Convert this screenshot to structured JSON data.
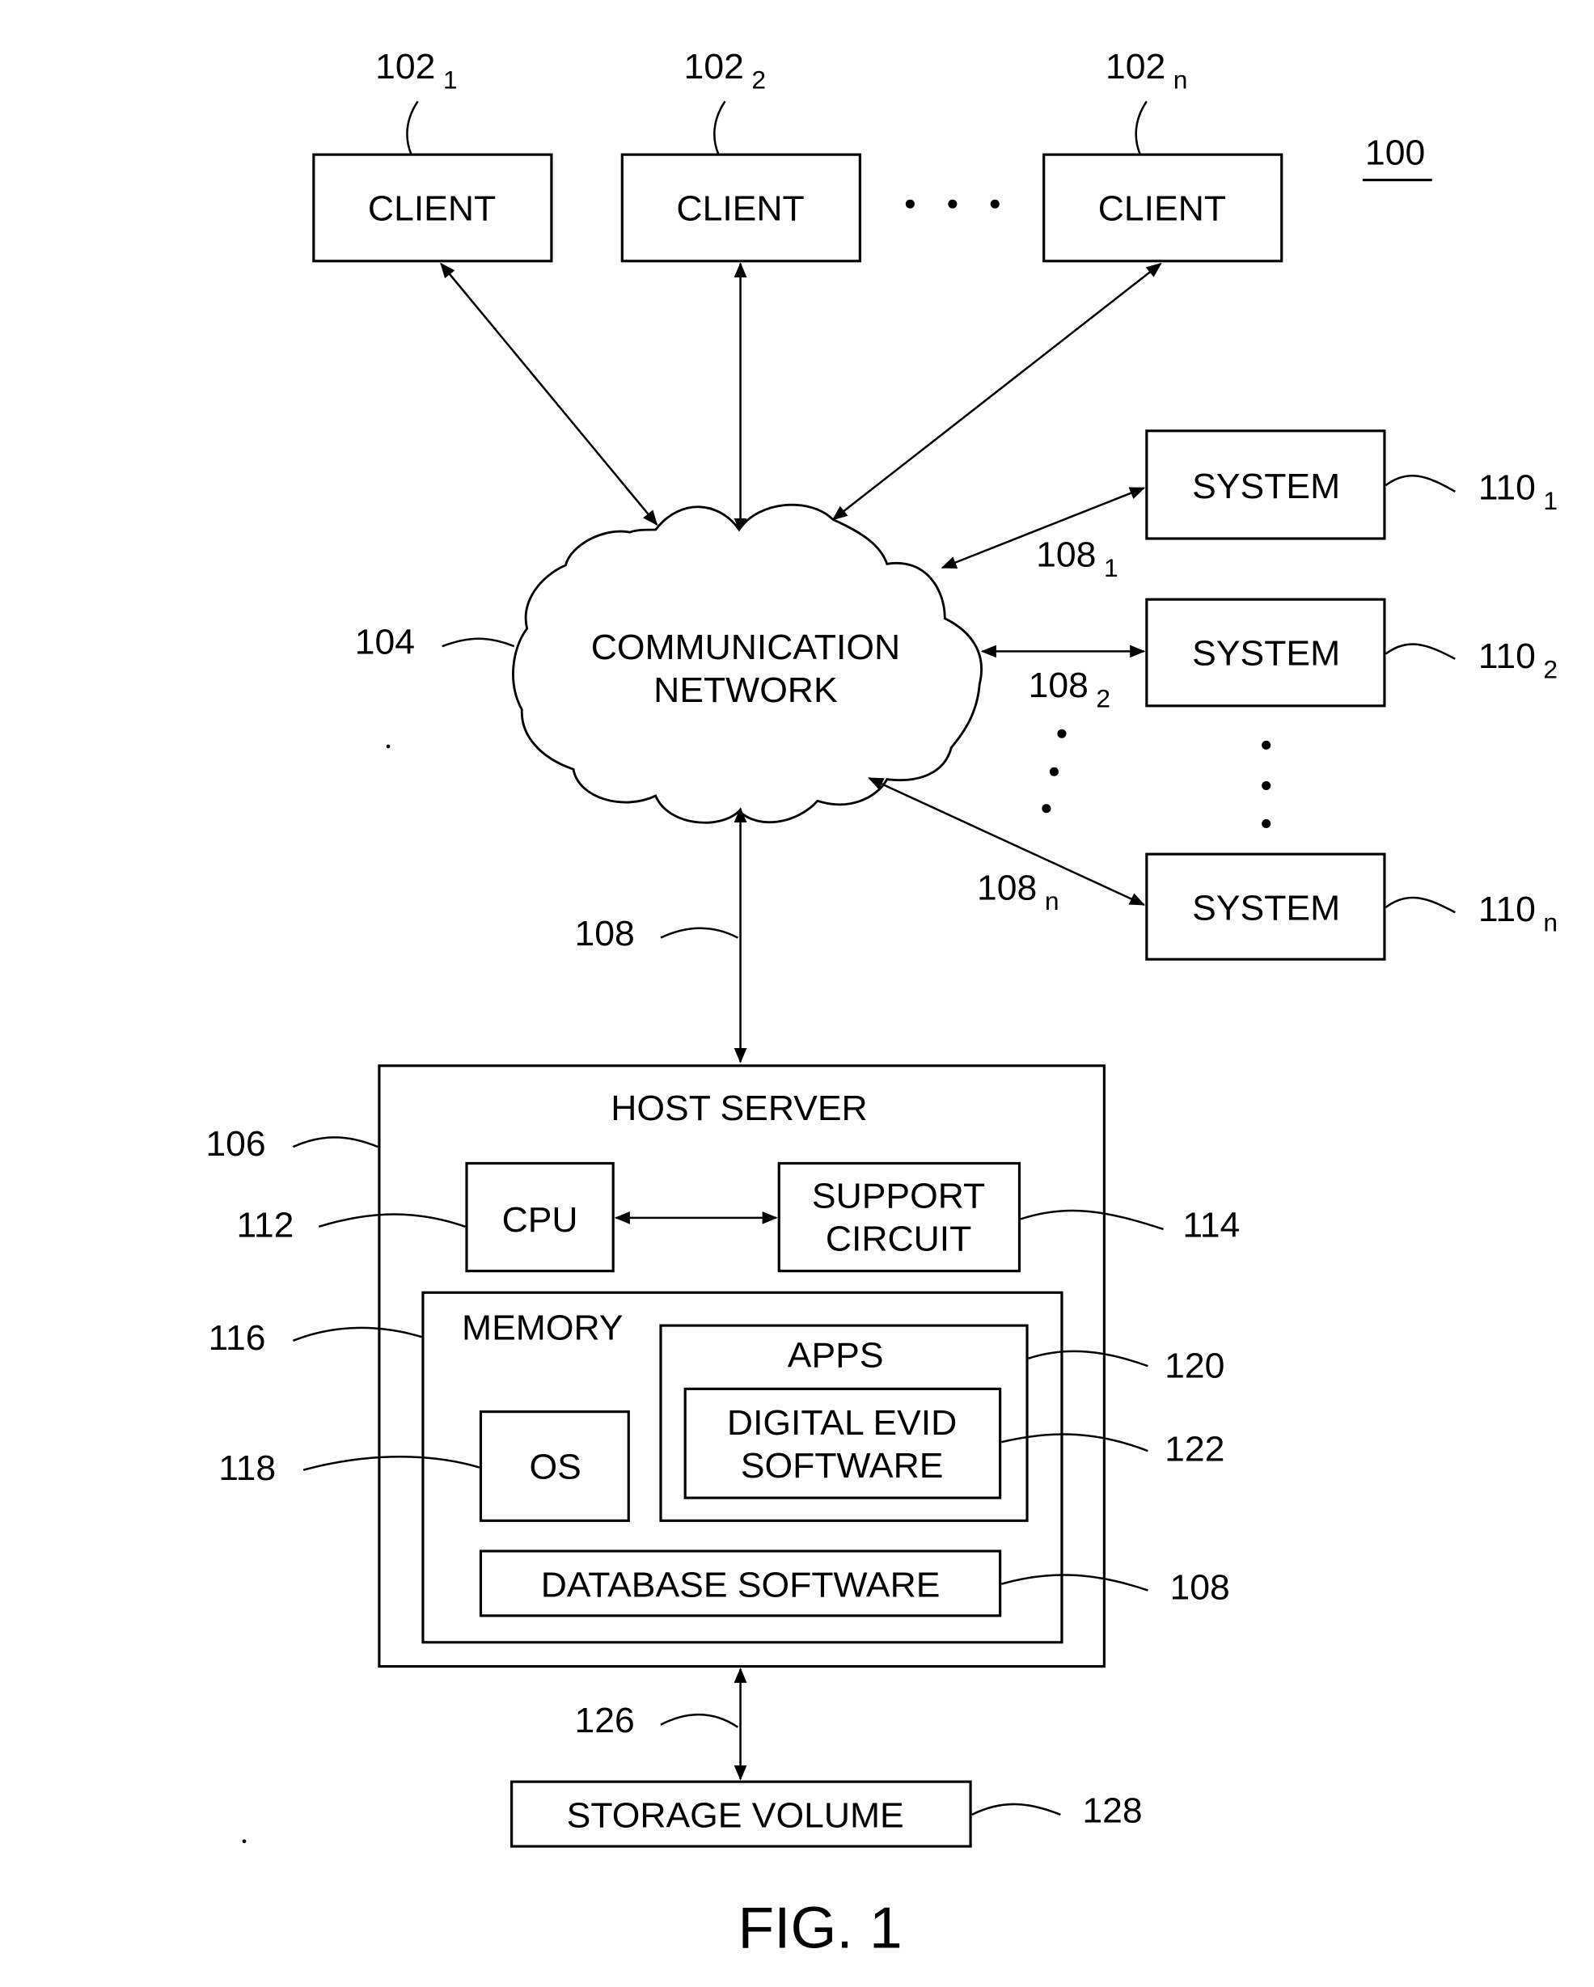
{
  "figure": {
    "title": "FIG. 1",
    "ref_number": "100"
  },
  "clients": [
    {
      "label": "CLIENT",
      "ref": "102",
      "sub": "1"
    },
    {
      "label": "CLIENT",
      "ref": "102",
      "sub": "2"
    },
    {
      "label": "CLIENT",
      "ref": "102",
      "sub": "n"
    }
  ],
  "network": {
    "line1": "COMMUNICATION",
    "line2": "NETWORK",
    "ref": "104"
  },
  "systems": [
    {
      "label": "SYSTEM",
      "ref": "110",
      "sub": "1",
      "link_ref": "108",
      "link_sub": "1"
    },
    {
      "label": "SYSTEM",
      "ref": "110",
      "sub": "2",
      "link_ref": "108",
      "link_sub": "2"
    },
    {
      "label": "SYSTEM",
      "ref": "110",
      "sub": "n",
      "link_ref": "108",
      "link_sub": "n"
    }
  ],
  "host_link_ref": "108",
  "host": {
    "label": "HOST SERVER",
    "ref": "106",
    "cpu": {
      "label": "CPU",
      "ref": "112"
    },
    "support": {
      "line1": "SUPPORT",
      "line2": "CIRCUIT",
      "ref": "114"
    },
    "memory": {
      "label": "MEMORY",
      "ref": "116"
    },
    "os": {
      "label": "OS",
      "ref": "118"
    },
    "apps": {
      "label": "APPS",
      "ref": "120"
    },
    "evid": {
      "line1": "DIGITAL EVID",
      "line2": "SOFTWARE",
      "ref": "122"
    },
    "database": {
      "label": "DATABASE SOFTWARE",
      "ref": "108"
    }
  },
  "storage_link_ref": "126",
  "storage": {
    "label": "STORAGE VOLUME",
    "ref": "128"
  }
}
